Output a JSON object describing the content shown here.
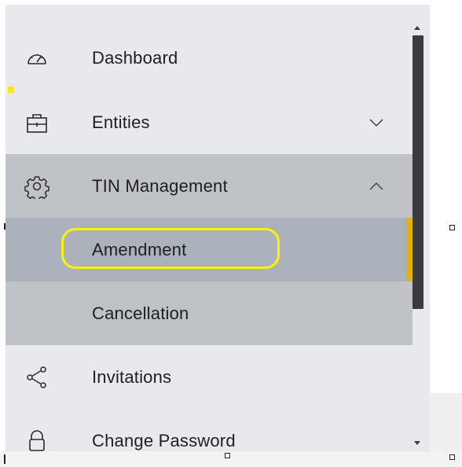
{
  "sidebar": {
    "items": [
      {
        "label": "Dashboard",
        "icon": "speedometer-icon"
      },
      {
        "label": "Entities",
        "icon": "briefcase-icon",
        "chevron": "down"
      },
      {
        "label": "TIN Management",
        "icon": "gear-icon",
        "chevron": "up",
        "children": [
          {
            "label": "Amendment",
            "active": true
          },
          {
            "label": "Cancellation"
          }
        ]
      },
      {
        "label": "Invitations",
        "icon": "share-icon"
      },
      {
        "label": "Change Password",
        "icon": "lock-icon"
      }
    ]
  },
  "colors": {
    "sidebar_bg": "#e7e9ec",
    "group_bg": "#bfc2c6",
    "active_bg": "#abb2bc",
    "active_indicator": "#e3b011",
    "highlight_annotation": "#fff10a"
  }
}
